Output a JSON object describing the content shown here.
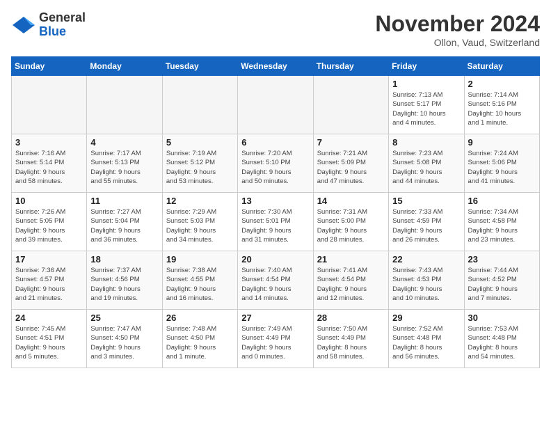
{
  "header": {
    "logo_line1": "General",
    "logo_line2": "Blue",
    "month": "November 2024",
    "location": "Ollon, Vaud, Switzerland"
  },
  "weekdays": [
    "Sunday",
    "Monday",
    "Tuesday",
    "Wednesday",
    "Thursday",
    "Friday",
    "Saturday"
  ],
  "weeks": [
    [
      {
        "day": "",
        "info": ""
      },
      {
        "day": "",
        "info": ""
      },
      {
        "day": "",
        "info": ""
      },
      {
        "day": "",
        "info": ""
      },
      {
        "day": "",
        "info": ""
      },
      {
        "day": "1",
        "info": "Sunrise: 7:13 AM\nSunset: 5:17 PM\nDaylight: 10 hours\nand 4 minutes."
      },
      {
        "day": "2",
        "info": "Sunrise: 7:14 AM\nSunset: 5:16 PM\nDaylight: 10 hours\nand 1 minute."
      }
    ],
    [
      {
        "day": "3",
        "info": "Sunrise: 7:16 AM\nSunset: 5:14 PM\nDaylight: 9 hours\nand 58 minutes."
      },
      {
        "day": "4",
        "info": "Sunrise: 7:17 AM\nSunset: 5:13 PM\nDaylight: 9 hours\nand 55 minutes."
      },
      {
        "day": "5",
        "info": "Sunrise: 7:19 AM\nSunset: 5:12 PM\nDaylight: 9 hours\nand 53 minutes."
      },
      {
        "day": "6",
        "info": "Sunrise: 7:20 AM\nSunset: 5:10 PM\nDaylight: 9 hours\nand 50 minutes."
      },
      {
        "day": "7",
        "info": "Sunrise: 7:21 AM\nSunset: 5:09 PM\nDaylight: 9 hours\nand 47 minutes."
      },
      {
        "day": "8",
        "info": "Sunrise: 7:23 AM\nSunset: 5:08 PM\nDaylight: 9 hours\nand 44 minutes."
      },
      {
        "day": "9",
        "info": "Sunrise: 7:24 AM\nSunset: 5:06 PM\nDaylight: 9 hours\nand 41 minutes."
      }
    ],
    [
      {
        "day": "10",
        "info": "Sunrise: 7:26 AM\nSunset: 5:05 PM\nDaylight: 9 hours\nand 39 minutes."
      },
      {
        "day": "11",
        "info": "Sunrise: 7:27 AM\nSunset: 5:04 PM\nDaylight: 9 hours\nand 36 minutes."
      },
      {
        "day": "12",
        "info": "Sunrise: 7:29 AM\nSunset: 5:03 PM\nDaylight: 9 hours\nand 34 minutes."
      },
      {
        "day": "13",
        "info": "Sunrise: 7:30 AM\nSunset: 5:01 PM\nDaylight: 9 hours\nand 31 minutes."
      },
      {
        "day": "14",
        "info": "Sunrise: 7:31 AM\nSunset: 5:00 PM\nDaylight: 9 hours\nand 28 minutes."
      },
      {
        "day": "15",
        "info": "Sunrise: 7:33 AM\nSunset: 4:59 PM\nDaylight: 9 hours\nand 26 minutes."
      },
      {
        "day": "16",
        "info": "Sunrise: 7:34 AM\nSunset: 4:58 PM\nDaylight: 9 hours\nand 23 minutes."
      }
    ],
    [
      {
        "day": "17",
        "info": "Sunrise: 7:36 AM\nSunset: 4:57 PM\nDaylight: 9 hours\nand 21 minutes."
      },
      {
        "day": "18",
        "info": "Sunrise: 7:37 AM\nSunset: 4:56 PM\nDaylight: 9 hours\nand 19 minutes."
      },
      {
        "day": "19",
        "info": "Sunrise: 7:38 AM\nSunset: 4:55 PM\nDaylight: 9 hours\nand 16 minutes."
      },
      {
        "day": "20",
        "info": "Sunrise: 7:40 AM\nSunset: 4:54 PM\nDaylight: 9 hours\nand 14 minutes."
      },
      {
        "day": "21",
        "info": "Sunrise: 7:41 AM\nSunset: 4:54 PM\nDaylight: 9 hours\nand 12 minutes."
      },
      {
        "day": "22",
        "info": "Sunrise: 7:43 AM\nSunset: 4:53 PM\nDaylight: 9 hours\nand 10 minutes."
      },
      {
        "day": "23",
        "info": "Sunrise: 7:44 AM\nSunset: 4:52 PM\nDaylight: 9 hours\nand 7 minutes."
      }
    ],
    [
      {
        "day": "24",
        "info": "Sunrise: 7:45 AM\nSunset: 4:51 PM\nDaylight: 9 hours\nand 5 minutes."
      },
      {
        "day": "25",
        "info": "Sunrise: 7:47 AM\nSunset: 4:50 PM\nDaylight: 9 hours\nand 3 minutes."
      },
      {
        "day": "26",
        "info": "Sunrise: 7:48 AM\nSunset: 4:50 PM\nDaylight: 9 hours\nand 1 minute."
      },
      {
        "day": "27",
        "info": "Sunrise: 7:49 AM\nSunset: 4:49 PM\nDaylight: 9 hours\nand 0 minutes."
      },
      {
        "day": "28",
        "info": "Sunrise: 7:50 AM\nSunset: 4:49 PM\nDaylight: 8 hours\nand 58 minutes."
      },
      {
        "day": "29",
        "info": "Sunrise: 7:52 AM\nSunset: 4:48 PM\nDaylight: 8 hours\nand 56 minutes."
      },
      {
        "day": "30",
        "info": "Sunrise: 7:53 AM\nSunset: 4:48 PM\nDaylight: 8 hours\nand 54 minutes."
      }
    ]
  ]
}
